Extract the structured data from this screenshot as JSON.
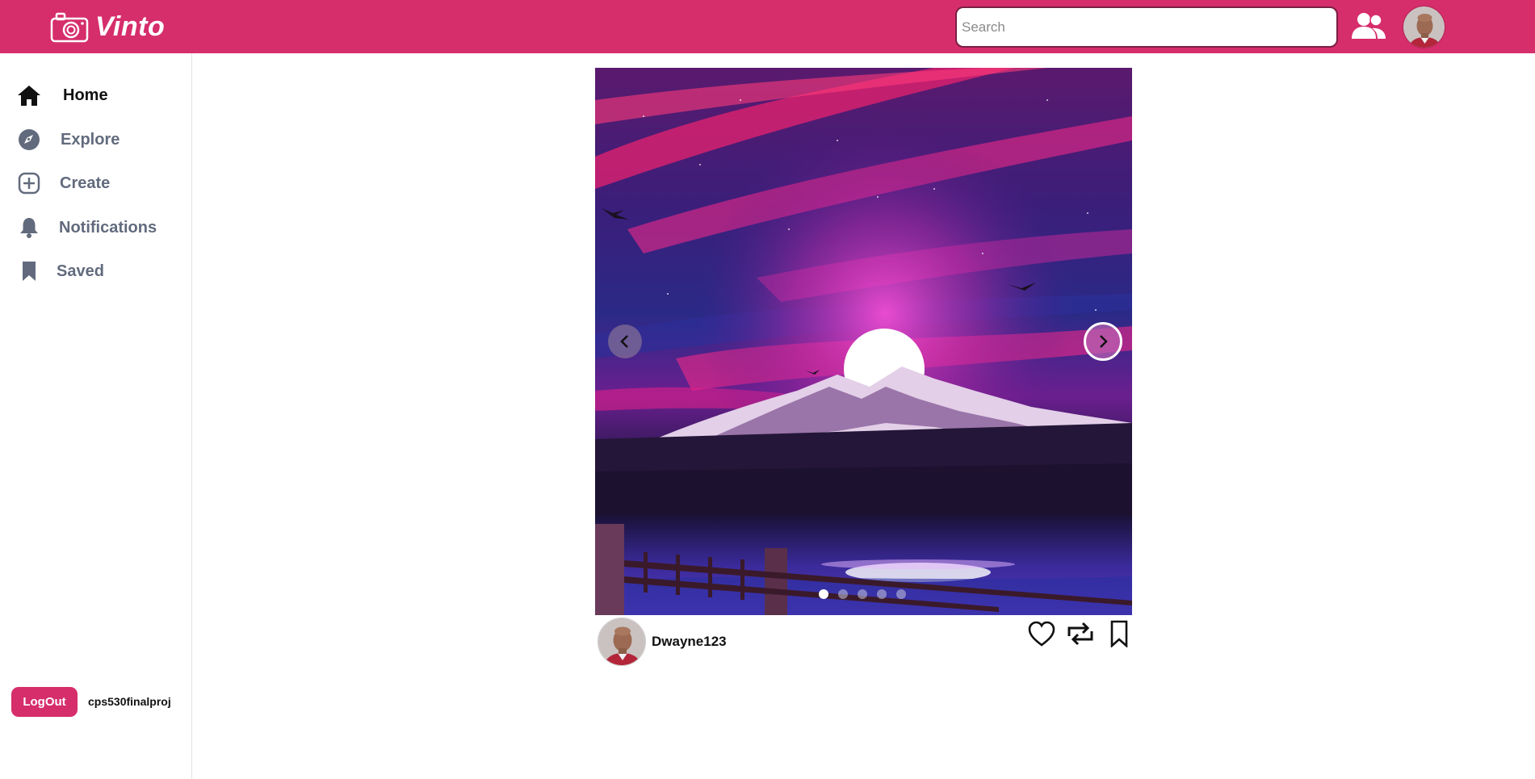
{
  "app": {
    "name": "Vinto",
    "brand_color": "#d62d6b"
  },
  "header": {
    "search_placeholder": "Search",
    "search_value": "",
    "icons": [
      "camera-icon",
      "friends-icon",
      "user-avatar"
    ]
  },
  "sidebar": {
    "items": [
      {
        "label": "Home",
        "icon": "home-icon",
        "active": true
      },
      {
        "label": "Explore",
        "icon": "compass-icon",
        "active": false
      },
      {
        "label": "Create",
        "icon": "plus-square-icon",
        "active": false
      },
      {
        "label": "Notifications",
        "icon": "bell-icon",
        "active": false
      },
      {
        "label": "Saved",
        "icon": "bookmark-icon",
        "active": false
      }
    ],
    "logout_label": "LogOut",
    "current_user": "cps530finalproj"
  },
  "post": {
    "username": "Dwayne123",
    "carousel": {
      "total_slides": 5,
      "active_slide": 1
    },
    "actions": [
      "heart-icon",
      "repost-icon",
      "bookmark-icon"
    ]
  }
}
